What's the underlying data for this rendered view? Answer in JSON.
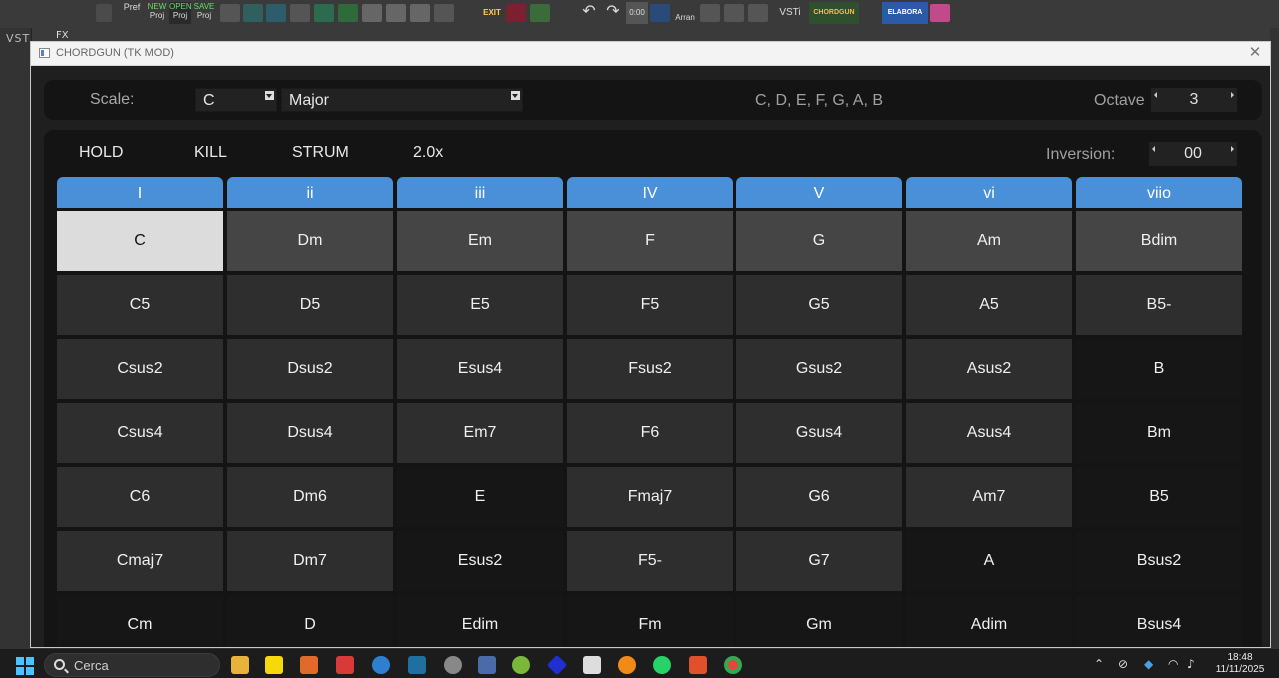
{
  "host": {
    "vst_tab": "VST",
    "fx_tab": "FX",
    "toolbar": {
      "pref": "Pref",
      "new_proj": [
        "NEW",
        "Proj"
      ],
      "open_proj": [
        "OPEN",
        "Proj"
      ],
      "save_proj": [
        "SAVE",
        "Proj"
      ],
      "exit": "EXIT",
      "time": "0:00",
      "arran": "Arran",
      "vsti": "VSTi",
      "chordgun": "CHORDGUN",
      "elabora": "ELABORA"
    }
  },
  "window": {
    "title": "CHORDGUN (TK MOD)",
    "close_glyph": "✕"
  },
  "scale": {
    "label": "Scale:",
    "root": "C",
    "type": "Major",
    "notes": "C, D, E, F, G, A, B",
    "octave_label": "Octave",
    "octave_value": "3"
  },
  "controls": {
    "hold": "HOLD",
    "kill": "KILL",
    "strum": "STRUM",
    "speed": "2.0x",
    "inversion_label": "Inversion:",
    "inversion_value": "00"
  },
  "grid": {
    "headers": [
      "I",
      "ii",
      "iii",
      "IV",
      "V",
      "vi",
      "viio"
    ],
    "rows": [
      [
        "C",
        "Dm",
        "Em",
        "F",
        "G",
        "Am",
        "Bdim"
      ],
      [
        "C5",
        "D5",
        "E5",
        "F5",
        "G5",
        "A5",
        "B5-"
      ],
      [
        "Csus2",
        "Dsus2",
        "Esus4",
        "Fsus2",
        "Gsus2",
        "Asus2",
        "B"
      ],
      [
        "Csus4",
        "Dsus4",
        "Em7",
        "F6",
        "Gsus4",
        "Asus4",
        "Bm"
      ],
      [
        "C6",
        "Dm6",
        "E",
        "Fmaj7",
        "G6",
        "Am7",
        "B5"
      ],
      [
        "Cmaj7",
        "Dm7",
        "Esus2",
        "F5-",
        "G7",
        "A",
        "Bsus2"
      ],
      [
        "Cm",
        "D",
        "Edim",
        "Fm",
        "Gm",
        "Adim",
        "Bsus4"
      ]
    ],
    "shades": [
      [
        "selected",
        "light",
        "light",
        "light",
        "light",
        "light",
        "light"
      ],
      [
        "mid",
        "mid",
        "mid",
        "mid",
        "mid",
        "mid",
        "mid"
      ],
      [
        "mid",
        "mid",
        "mid",
        "mid",
        "mid",
        "mid",
        "dark"
      ],
      [
        "mid",
        "mid",
        "mid",
        "mid",
        "mid",
        "mid",
        "dark"
      ],
      [
        "mid",
        "mid",
        "dark",
        "mid",
        "mid",
        "mid",
        "dark"
      ],
      [
        "mid",
        "mid",
        "dark",
        "mid",
        "mid",
        "dark",
        "dark"
      ],
      [
        "dark",
        "dark",
        "dark",
        "dark",
        "dark",
        "dark",
        "dark"
      ]
    ]
  },
  "taskbar": {
    "search_placeholder": "Cerca",
    "time": "18:48",
    "date": "11/11/2025"
  },
  "colors": {
    "header_blue": "#4a90d9",
    "selected": "#dcdcdc",
    "cell_light": "#454545",
    "cell_mid": "#2e2e2e",
    "cell_dark": "#161616"
  }
}
